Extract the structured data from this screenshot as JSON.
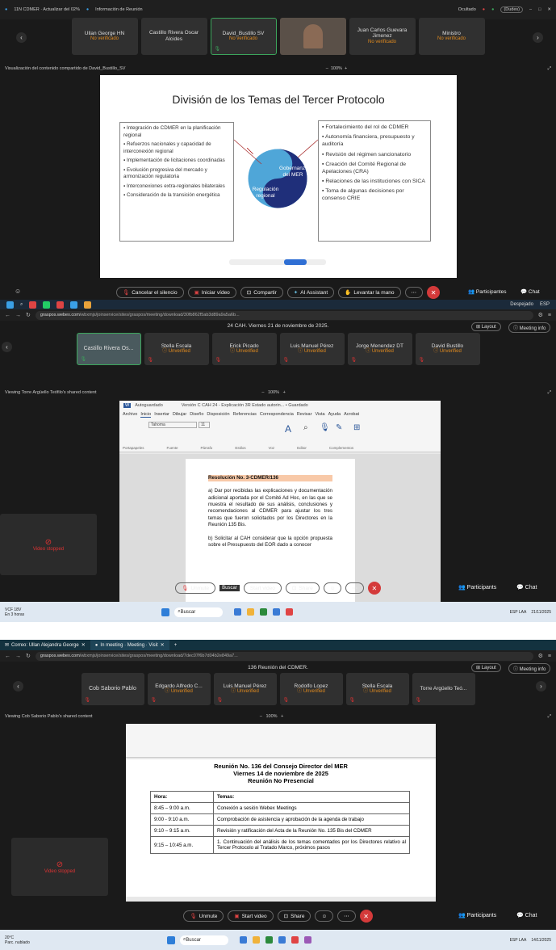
{
  "s1": {
    "titlebar": {
      "left1": "11N CDMER · Actualizar del 02%",
      "left2": "Información de Reunión",
      "right": "Ocultado",
      "dots": "(Dudes)"
    },
    "participants": [
      {
        "name": "Ullan George HN",
        "status": "No verificado"
      },
      {
        "name": "Castillo Rivera Oscar Alcides",
        "status": ""
      },
      {
        "name": "David_Bustillo SV",
        "status": "No verificado"
      },
      {
        "name": "",
        "status": ""
      },
      {
        "name": "Juan Carlos Guevara Jimenez",
        "status": "No verificado"
      },
      {
        "name": "Ministro",
        "status": "No verificado"
      }
    ],
    "share_label": "Visualización del contenido compartido de David_Bustillo_SV",
    "zoom": "100%",
    "slide": {
      "title": "División de los Temas del Tercer Protocolo",
      "left_items": [
        "Integración de CDMER en la planificación regional",
        "Refuerzos nacionales y capacidad de interconexión regional",
        "Implementación de licitaciones coordinadas",
        "Evolución progresiva del mercado y armonización regulatoria",
        "Interconexiones extra-regionales bilaterales",
        "Consideración de la transición energética"
      ],
      "right_items": [
        "Fortalecimiento del rol de CDMER",
        "Autonomía financiera, presupuesto y auditoría",
        "Revisión del régimen sancionatorio",
        "Creación del Comité Regional de Apelaciones (CRA)",
        "Relaciones de las instituciones con SICA",
        "Toma de algunas decisiones por consenso CRIE"
      ],
      "yin_top": "Gobernanza del MER",
      "yin_bottom": "Regulación regional"
    },
    "controls": {
      "mute": "Cancelar el silencio",
      "video": "Iniciar vídeo",
      "share": "Compartir",
      "ai": "AI Assistant",
      "hand": "Levantar la mano",
      "participants": "Participantes",
      "chat": "Chat"
    },
    "taskbar": {
      "weather": "Despejado",
      "time": "",
      "lang": "ESP"
    }
  },
  "s2": {
    "url_host": "graspos.webex.com",
    "url_path": "/wbxmjs/joinservice/sites/graspos/meeting/download/30fb862f5ab3d89a9a5a6b...",
    "meeting_title": "24 CAH. Viernes 21 de noviembre de 2025.",
    "layout": "Layout",
    "info": "Meeting info",
    "participants": [
      {
        "name": "Castillo Rivera Os...",
        "status": ""
      },
      {
        "name": "Stella Escala",
        "status": "Unverified"
      },
      {
        "name": "Erick Picado",
        "status": "Unverified"
      },
      {
        "name": "Luis Manuel Pérez",
        "status": "Unverified"
      },
      {
        "name": "Jorge Menendez DT",
        "status": "Unverified"
      },
      {
        "name": "David Bustillo",
        "status": "Unverified"
      }
    ],
    "share_label": "Viewing Torre Argüello Teófilo's shared content",
    "zoom": "100%",
    "word": {
      "title": "Versión C CAH 24 - Explicación 3R Estado autorin... • Guardado",
      "autosave": "Autoguardado",
      "menu": [
        "Archivo",
        "Inicio",
        "Insertar",
        "Dibujar",
        "Diseño",
        "Disposición",
        "Referencias",
        "Correspondencia",
        "Revisar",
        "Vista",
        "Ayuda",
        "Acrobat"
      ],
      "groups": [
        "Portapapeles",
        "Fuente",
        "Párrafo",
        "Estilos",
        "Voz",
        "Editor",
        "Complementos"
      ],
      "font": "Tahoma",
      "size": "11",
      "heading": "Resolución No. 3-CDMER/136",
      "para_a": "a)  Dar por recibidas las explicaciones y documentación adicional aportada por el Comité Ad Hoc, en las que se muestra el resultado de sus análisis, conclusiones y recomendaciones al CDMER para ajustar los tres temas que fueron solicitados por los Directores en la Reunión 135 Bis.",
      "para_b": "b)  Solicitar al CAH considerar que la opción propuesta sobre el Presupuesto del EOR dado a conocer",
      "status": "Página 1 de 2   321 palabras   Español (España)   Predicciones de texto: activado",
      "zoomdoc": "100 %"
    },
    "video_stopped": "Video stopped",
    "controls": {
      "mute": "Unmute",
      "tooltip": "Buscar",
      "video": "Start video",
      "share": "Share",
      "participants": "Participants",
      "chat": "Chat"
    },
    "taskbar": {
      "weather": "VCF 18V",
      "weather2": "En 3 horas",
      "search": "Buscar",
      "lang": "ESP LAA",
      "date": "21/11/2025"
    }
  },
  "s3": {
    "tabs": [
      "Correo: Ullan Alejandra George",
      "In meeting · Meeting · Visit"
    ],
    "url_host": "graspos.webex.com",
    "url_path": "/wbxmjs/joinservice/sites/graspos/meeting/download/7dec07f6b7d04b2e849a7...",
    "meeting_title": "136 Reunión del CDMER.",
    "layout": "Layout",
    "info": "Meeting info",
    "participants": [
      {
        "name": "Cob Saborio Pablo",
        "status": ""
      },
      {
        "name": "Edgardo Alfredo C...",
        "status": "Unverified"
      },
      {
        "name": "Luis Manuel Pérez",
        "status": "Unverified"
      },
      {
        "name": "Rodolfo Lopez",
        "status": "Unverified"
      },
      {
        "name": "Stella Escala",
        "status": "Unverified"
      },
      {
        "name": "Torre Argüello Teó...",
        "status": ""
      }
    ],
    "share_label": "Viewing Cob Saborio Pablo's shared content",
    "zoom": "100%",
    "doc": {
      "title1": "Reunión No. 136 del Consejo Director del MER",
      "title2": "Viernes 14 de noviembre de 2025",
      "title3": "Reunión No Presencial",
      "head_time": "Hora:",
      "head_topic": "Temas:",
      "rows": [
        {
          "time": "8:45 – 9:00 a.m.",
          "topic": "Conexión a sesión Webex Meetings"
        },
        {
          "time": "9:00 - 9:10 a.m.",
          "topic": "Comprobación de asistencia y aprobación de la agenda de trabajo"
        },
        {
          "time": "9:10 – 9:15 a.m.",
          "topic": "Revisión y ratificación del Acta de la Reunión No. 135 Bis del CDMER"
        },
        {
          "time": "9:15 – 10:45 a.m.",
          "topic": "1. Continuación del análisis de los temas comentados por los Directores relativo al Tercer Protocolo al Tratado Marco, próximos pasos"
        }
      ]
    },
    "video_stopped": "Video stopped",
    "controls": {
      "mute": "Unmute",
      "video": "Start video",
      "share": "Share",
      "participants": "Participants",
      "chat": "Chat"
    },
    "taskbar": {
      "weather": "20°C",
      "weather2": "Parc. nublado",
      "search": "Buscar",
      "lang": "ESP LAA",
      "date": "14/11/2025"
    }
  }
}
